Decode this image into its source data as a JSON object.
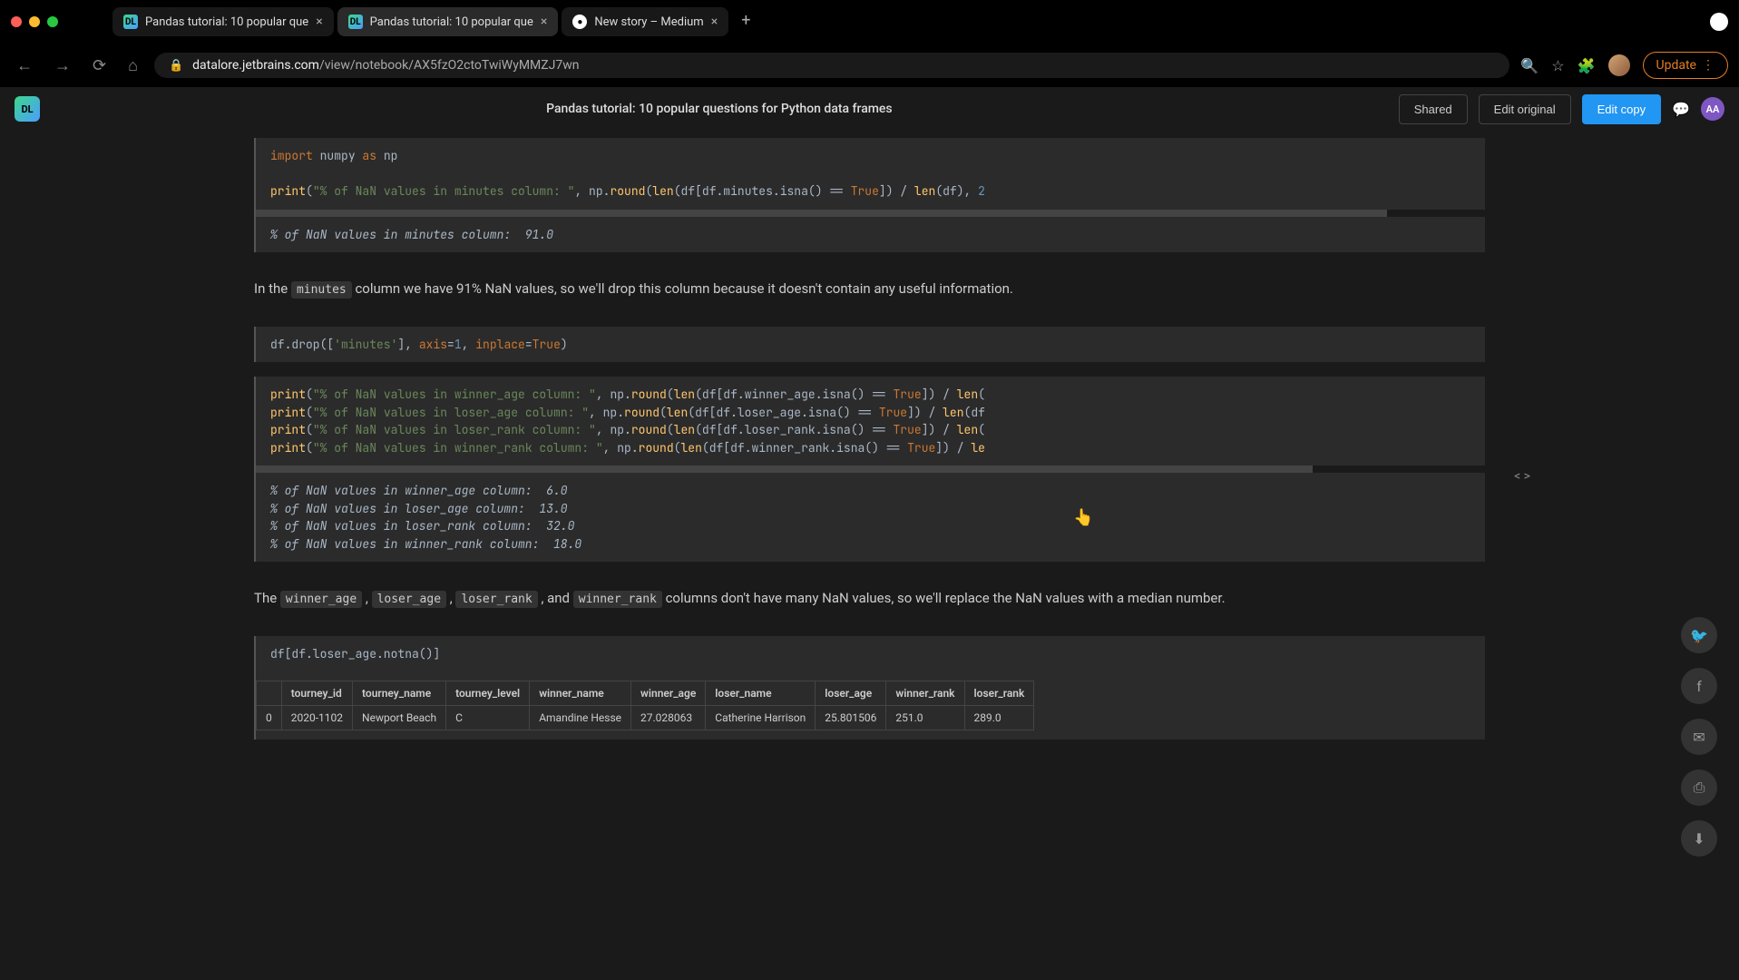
{
  "window": {
    "tabs": [
      {
        "title": "Pandas tutorial: 10 popular que",
        "favicon": "DL"
      },
      {
        "title": "Pandas tutorial: 10 popular que",
        "favicon": "DL",
        "active": true
      },
      {
        "title": "New story – Medium",
        "favicon": "●"
      }
    ],
    "new_tab": "+"
  },
  "url": {
    "back": "←",
    "forward": "→",
    "refresh": "⟳",
    "home": "⌂",
    "lock": "🔒",
    "domain": "datalore.jetbrains.com",
    "path": "/view/notebook/AX5fzO2ctoTwiWyMMZJ7wn",
    "search": "⊕",
    "star": "☆",
    "ext": "✦",
    "update": "Update",
    "update_more": "⋮"
  },
  "header": {
    "logo": "DL",
    "title": "Pandas tutorial: 10 popular questions for Python data frames",
    "shared": "Shared",
    "edit_original": "Edit original",
    "edit_copy": "Edit copy",
    "notif": "💬",
    "avatar": "AA"
  },
  "cells": {
    "code1_line1": "import numpy as np",
    "code1_line2_parts": {
      "print": "print",
      "open": "(",
      "str": "\"% of NaN values in minutes column: \"",
      "comma": ", np.",
      "round": "round",
      "p2": "(",
      "len": "len",
      "p3": "(df[df.minutes.isna() == ",
      "true": "True",
      "p4": "]) / ",
      "len2": "len",
      "p5": "(df), ",
      "two": "2"
    },
    "output1": "% of NaN values in minutes column:  91.0",
    "md1_pre": "In the ",
    "md1_code": "minutes",
    "md1_post": " column we have 91% NaN values, so we'll drop this column because it doesn't contain any useful information.",
    "code2_parts": {
      "df": "df.drop([",
      "str": "'minutes'",
      "close": "], ",
      "axis": "axis",
      "eq1": "=",
      "one": "1",
      "comma": ", ",
      "inplace": "inplace",
      "eq2": "=",
      "true": "True",
      "end": ")"
    },
    "code3_line1": "print(\"% of NaN values in winner_age column: \", np.round(len(df[df.winner_age.isna() == True]) / len(",
    "code3_line2": "print(\"% of NaN values in loser_age column: \", np.round(len(df[df.loser_age.isna() == True]) / len(df",
    "code3_line3": "print(\"% of NaN values in loser_rank column: \", np.round(len(df[df.loser_rank.isna() == True]) / len(",
    "code3_line4": "print(\"% of NaN values in winner_rank column: \", np.round(len(df[df.winner_rank.isna() == True]) / le",
    "output3_line1": "% of NaN values in winner_age column:  6.0",
    "output3_line2": "% of NaN values in loser_age column:  13.0",
    "output3_line3": "% of NaN values in loser_rank column:  32.0",
    "output3_line4": "% of NaN values in winner_rank column:  18.0",
    "md2_pre": "The ",
    "md2_c1": "winner_age",
    "md2_s1": " , ",
    "md2_c2": "loser_age",
    "md2_s2": " , ",
    "md2_c3": "loser_rank",
    "md2_s3": " , and ",
    "md2_c4": "winner_rank",
    "md2_post": " columns don't have many NaN values, so we'll replace the NaN values with a median number.",
    "code4": "df[df.loser_age.notna()]",
    "insert_code": "< >"
  },
  "table": {
    "headers": [
      "",
      "tourney_id",
      "tourney_name",
      "tourney_level",
      "winner_name",
      "winner_age",
      "loser_name",
      "loser_age",
      "winner_rank",
      "loser_rank"
    ],
    "rows": [
      [
        "0",
        "2020-1102",
        "Newport Beach",
        "C",
        "Amandine Hesse",
        "27.028063",
        "Catherine Harrison",
        "25.801506",
        "251.0",
        "289.0"
      ]
    ]
  },
  "float": {
    "twitter": "𝕏",
    "facebook": "f",
    "mail": "✉",
    "print": "⎙",
    "download": "⬇"
  }
}
